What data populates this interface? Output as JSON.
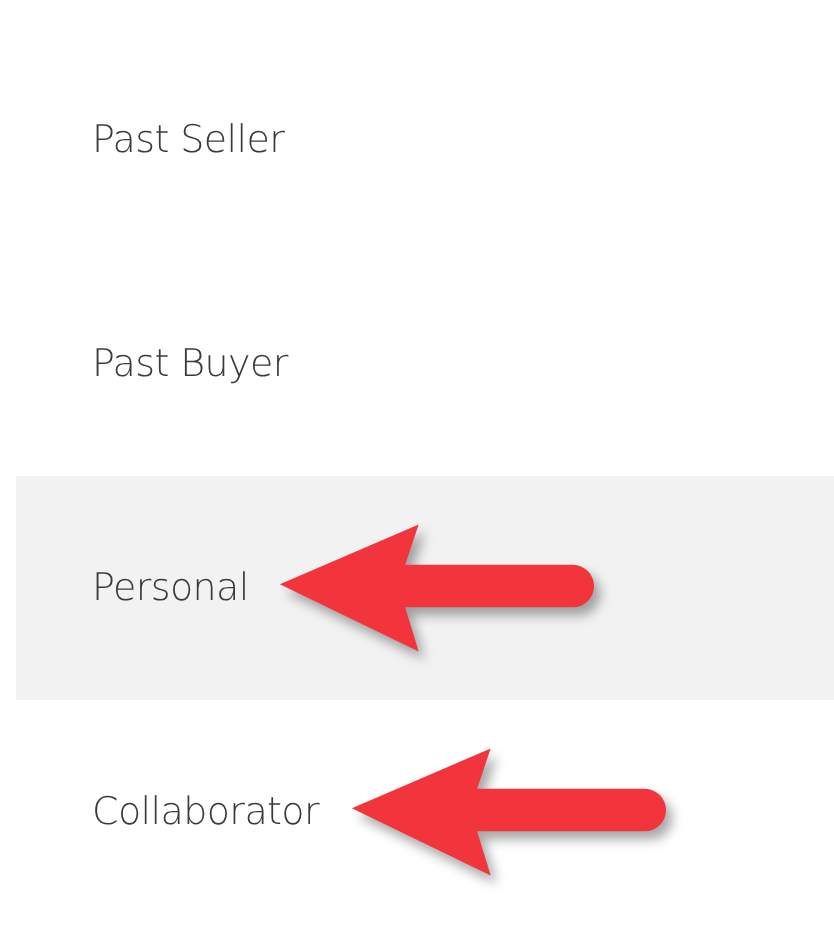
{
  "items": [
    {
      "label": "Past Seller",
      "selected": false,
      "annotated": false
    },
    {
      "label": "Past Buyer",
      "selected": false,
      "annotated": false
    },
    {
      "label": "Personal",
      "selected": true,
      "annotated": true
    },
    {
      "label": "Collaborator",
      "selected": false,
      "annotated": true
    }
  ]
}
